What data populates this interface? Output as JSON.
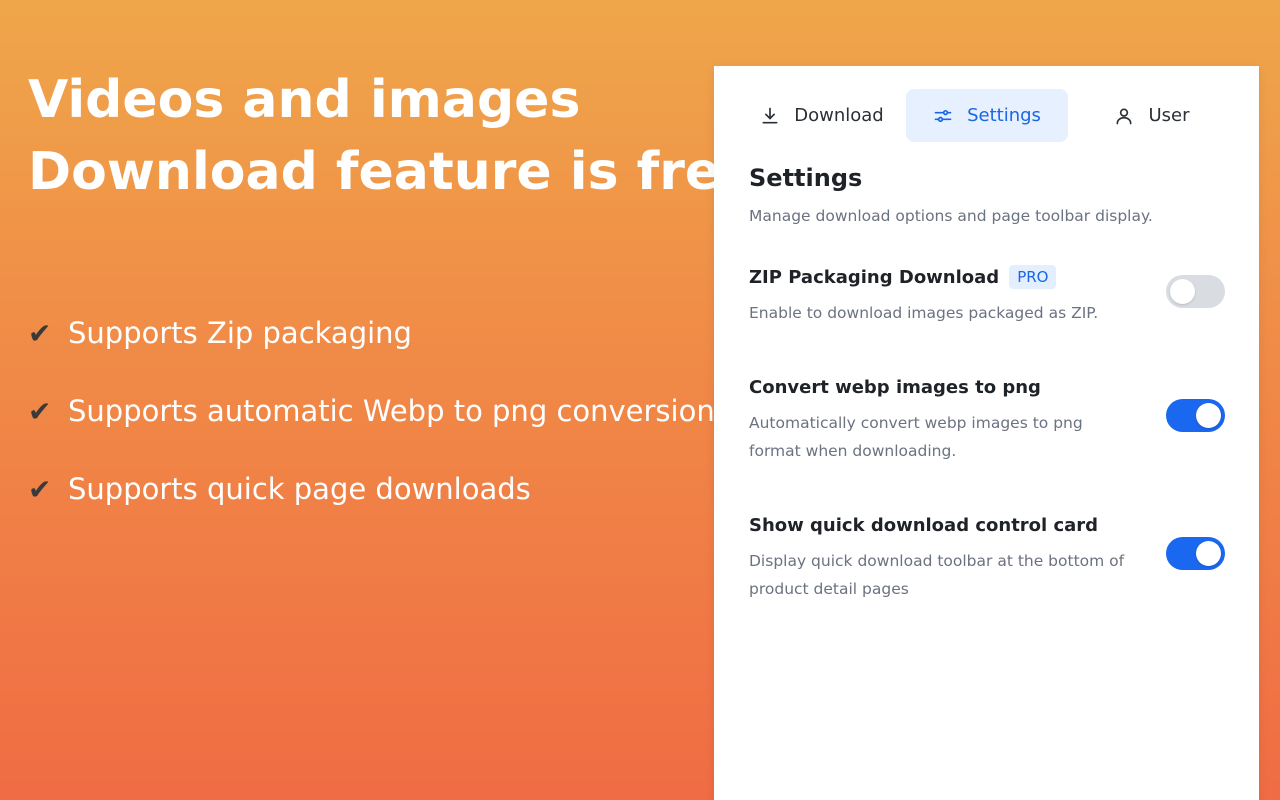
{
  "promo": {
    "headline_line1": "Videos and images",
    "headline_line2": "Download feature is free",
    "features": [
      "Supports Zip packaging",
      "Supports automatic Webp to png conversion",
      "Supports quick page downloads"
    ],
    "check_glyph": "✔"
  },
  "tabs": {
    "download": "Download",
    "settings": "Settings",
    "user": "User",
    "active": "settings"
  },
  "settings": {
    "title": "Settings",
    "description": "Manage download options and page toolbar display.",
    "items": [
      {
        "title": "ZIP Packaging Download",
        "badge": "PRO",
        "description": "Enable to download images packaged as ZIP.",
        "enabled": false
      },
      {
        "title": "Convert webp images to png",
        "description": "Automatically convert webp images to png format when downloading.",
        "enabled": true
      },
      {
        "title": "Show quick download control card",
        "description": "Display quick download toolbar at the bottom of product detail pages",
        "enabled": true
      }
    ]
  },
  "colors": {
    "accent": "#1a67f0",
    "toggle_off": "#d9dce1",
    "background_top": "#efa64a",
    "background_bottom": "#f06c44"
  },
  "icons": {
    "download_tab": "download-icon",
    "settings_tab": "sliders-icon",
    "user_tab": "user-icon"
  }
}
